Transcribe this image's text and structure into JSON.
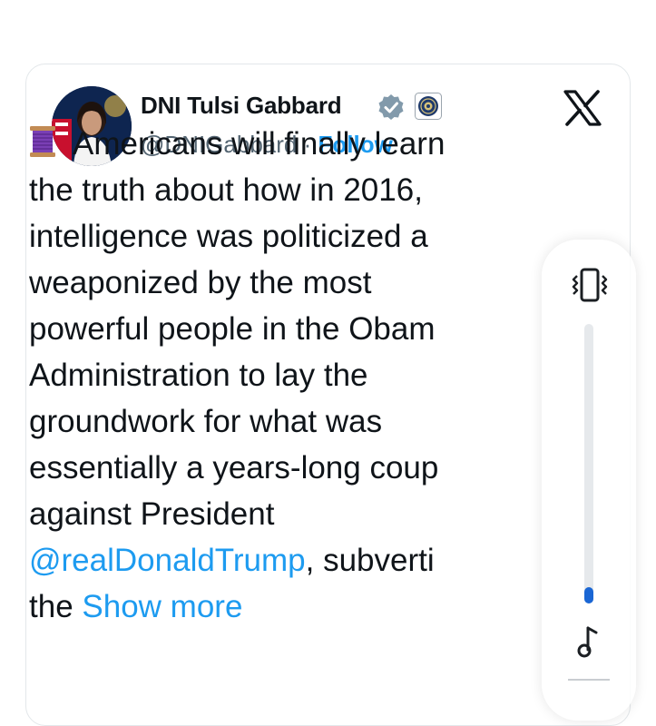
{
  "post": {
    "author_name": "DNI Tulsi Gabbard",
    "handle": "@DNIGabbard",
    "separator": "·",
    "follow_label": "Follow",
    "verified_icon": "verified-badge-icon",
    "affiliate_icon": "odni-seal-icon",
    "platform_icon": "x-logo-icon",
    "lead_emoji_icon": "thread-spool-icon",
    "lines": [
      "Americans will finally learn",
      "the truth about how in 2016,",
      "intelligence was politicized a",
      "weaponized by the most",
      "powerful people in the Obam",
      "Administration to lay the",
      "groundwork for what was",
      "essentially a years-long coup",
      "against President"
    ],
    "mention": "@realDonaldTrump",
    "mention_suffix": ", subverti",
    "last_line_prefix": "the ",
    "show_more_label": "Show more"
  },
  "volume_overlay": {
    "mode_icon": "vibrate-icon",
    "media_icon": "music-note-icon",
    "level_fraction": 0.06,
    "accent_color": "#1a66d4"
  },
  "colors": {
    "link": "#1d9bf0",
    "text": "#0f1419",
    "muted": "#536471"
  }
}
